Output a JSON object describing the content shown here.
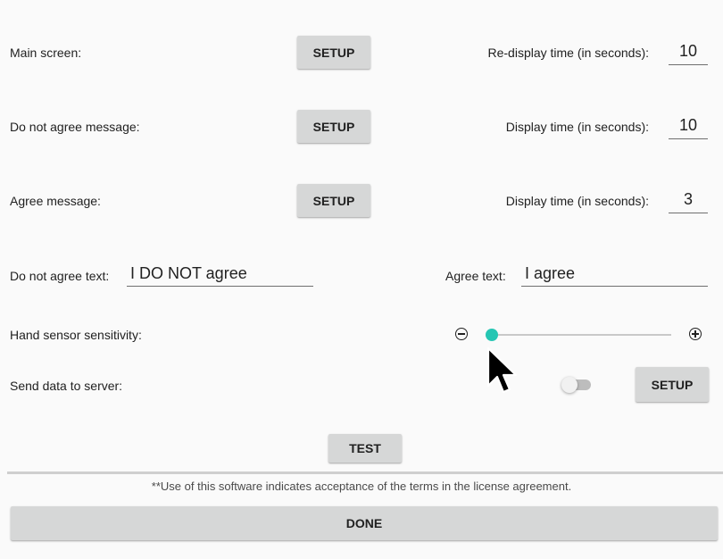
{
  "rows": {
    "main_screen": {
      "label": "Main screen:",
      "button": "SETUP",
      "time_label": "Re-display time (in seconds):",
      "time_value": "10"
    },
    "do_not_agree_message": {
      "label": "Do not agree message:",
      "button": "SETUP",
      "time_label": "Display time (in seconds):",
      "time_value": "10"
    },
    "agree_message": {
      "label": "Agree message:",
      "button": "SETUP",
      "time_label": "Display time (in seconds):",
      "time_value": "3"
    }
  },
  "texts": {
    "do_not_agree_label": "Do not agree text:",
    "do_not_agree_value": "I DO NOT agree",
    "agree_label": "Agree text:",
    "agree_value": "I agree"
  },
  "sensor": {
    "label": "Hand sensor sensitivity:",
    "value_fraction": 0.0,
    "minus_icon": "minus-circle-icon",
    "plus_icon": "plus-circle-icon"
  },
  "server": {
    "label": "Send data to server:",
    "toggle_on": false,
    "button": "SETUP"
  },
  "test_button": "TEST",
  "license_note": "**Use of this software indicates acceptance of the terms in the license agreement.",
  "done_button": "DONE",
  "colors": {
    "accent": "#26c6b3",
    "button_bg": "#d6d7d7",
    "background": "#fafafa"
  }
}
